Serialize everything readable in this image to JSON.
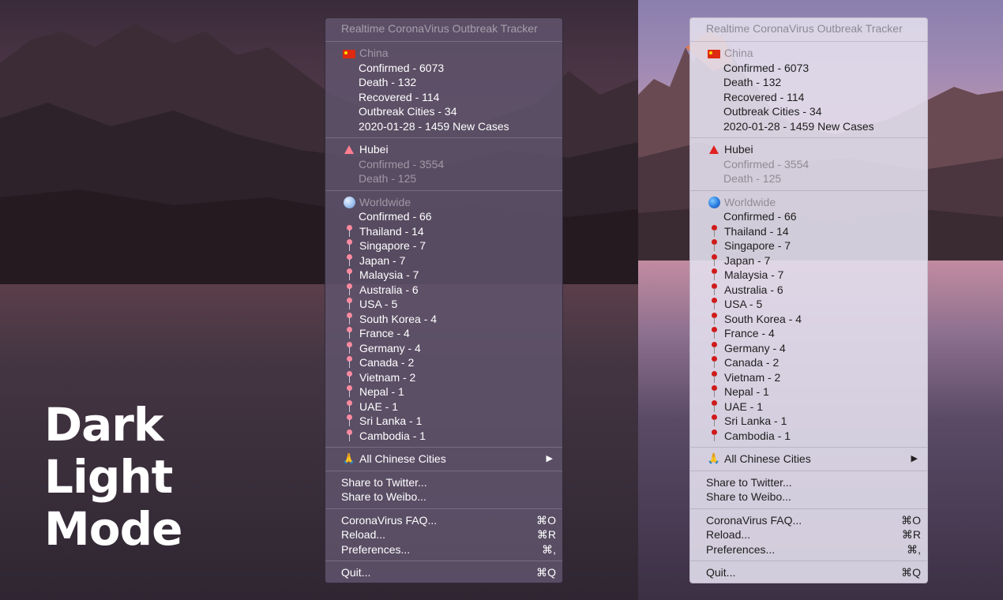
{
  "heading": {
    "line1": "Dark",
    "line2": "Light",
    "line3": "Mode"
  },
  "menu": {
    "title": "Realtime CoronaVirus Outbreak Tracker",
    "china": {
      "label": "China",
      "confirmed": "Confirmed - 6073",
      "death": "Death - 132",
      "recovered": "Recovered - 114",
      "cities": "Outbreak Cities - 34",
      "new_cases": "2020-01-28 - 1459 New Cases"
    },
    "hubei": {
      "label": "Hubei",
      "confirmed": "Confirmed - 3554",
      "death": "Death - 125"
    },
    "worldwide": {
      "label": "Worldwide",
      "confirmed": "Confirmed - 66",
      "countries": [
        "Thailand - 14",
        "Singapore - 7",
        "Japan - 7",
        "Malaysia - 7",
        "Australia - 6",
        "USA - 5",
        "South Korea - 4",
        "France - 4",
        "Germany - 4",
        "Canada - 2",
        "Vietnam - 2",
        "Nepal - 1",
        "UAE - 1",
        "Sri Lanka - 1",
        "Cambodia - 1"
      ]
    },
    "all_cities": "All Chinese Cities",
    "share_twitter": "Share to Twitter...",
    "share_weibo": "Share to Weibo...",
    "faq": "CoronaVirus FAQ...",
    "faq_shortcut": "⌘O",
    "reload": "Reload...",
    "reload_shortcut": "⌘R",
    "preferences": "Preferences...",
    "preferences_shortcut": "⌘,",
    "quit": "Quit...",
    "quit_shortcut": "⌘Q"
  },
  "icons": {
    "china": "china-flag-icon",
    "hubei": "red-triangle-icon",
    "worldwide": "globe-icon",
    "country": "pushpin-icon",
    "all_cities": "folded-hands-icon",
    "submenu": "chevron-right-icon"
  }
}
